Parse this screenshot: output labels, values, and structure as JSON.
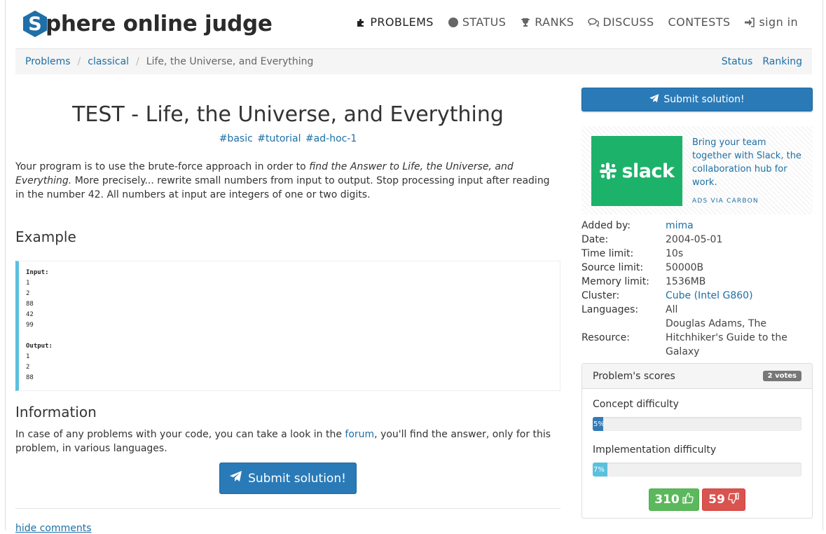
{
  "header": {
    "logo_text": "phere online judge",
    "logo_letter": "S",
    "nav": [
      {
        "label": "PROBLEMS",
        "icon": "puzzle-icon"
      },
      {
        "label": "STATUS",
        "icon": "circle-icon"
      },
      {
        "label": "RANKS",
        "icon": "trophy-icon"
      },
      {
        "label": "DISCUSS",
        "icon": "comments-icon"
      },
      {
        "label": "CONTESTS",
        "icon": ""
      },
      {
        "label": "sign in",
        "icon": "sign-in-icon"
      }
    ]
  },
  "breadcrumb": {
    "items": [
      "Problems",
      "classical"
    ],
    "current": "Life, the Universe, and Everything",
    "right_links": [
      "Status",
      "Ranking"
    ]
  },
  "problem": {
    "title": "TEST - Life, the Universe, and Everything",
    "tags": [
      "#basic",
      "#tutorial",
      "#ad-hoc-1"
    ],
    "desc_part1": "Your program is to use the brute-force approach in order to ",
    "desc_italic": "find the Answer to Life, the Universe, and Everything.",
    "desc_part2": " More precisely... rewrite small numbers from input to output. Stop processing input after reading in the number 42. All numbers at input are integers of one or two digits.",
    "example_heading": "Example",
    "example": {
      "input_label": "Input:",
      "input_lines": [
        "1",
        "2",
        "88",
        "42",
        "99"
      ],
      "output_label": "Output:",
      "output_lines": [
        "1",
        "2",
        "88"
      ]
    },
    "info_heading": "Information",
    "info_part1": "In case of any problems with your code, you can take a look in the ",
    "info_link": "forum",
    "info_part2": ", you'll find the answer, only for this problem, in various languages.",
    "submit_label": "Submit solution!",
    "hide_comments": "hide comments"
  },
  "sidebar": {
    "submit_label": "Submit solution!",
    "ad": {
      "brand": "slack",
      "text": "Bring your team together with Slack, the collaboration hub for work.",
      "footer": "ADS VIA CARBON",
      "brand_color": "#1db26a"
    },
    "meta": {
      "added_by_k": "Added by:",
      "added_by_v": "mima",
      "date_k": "Date:",
      "date_v": "2004-05-01",
      "time_k": "Time limit:",
      "time_v": "10s",
      "source_k": "Source limit:",
      "source_v": "50000B",
      "memory_k": "Memory limit:",
      "memory_v": "1536MB",
      "cluster_k": "Cluster:",
      "cluster_v": "Cube (Intel G860)",
      "languages_k": "Languages:",
      "languages_v": "All",
      "resource_k": "Resource:",
      "resource_v": "Douglas Adams, The Hitchhiker's Guide to the Galaxy"
    },
    "scores": {
      "title": "Problem's scores",
      "votes": "2 votes",
      "concept_label": "Concept difficulty",
      "concept_pct": 5,
      "concept_text": "5%",
      "impl_label": "Implementation difficulty",
      "impl_pct": 7,
      "impl_text": "7%",
      "upvotes": "310",
      "downvotes": "59"
    }
  },
  "colors": {
    "link": "#1d6fa5",
    "primary_button": "#2a7ab8",
    "example_border": "#5bc0de",
    "vote_up": "#5cb85c",
    "vote_down": "#d9534f"
  }
}
